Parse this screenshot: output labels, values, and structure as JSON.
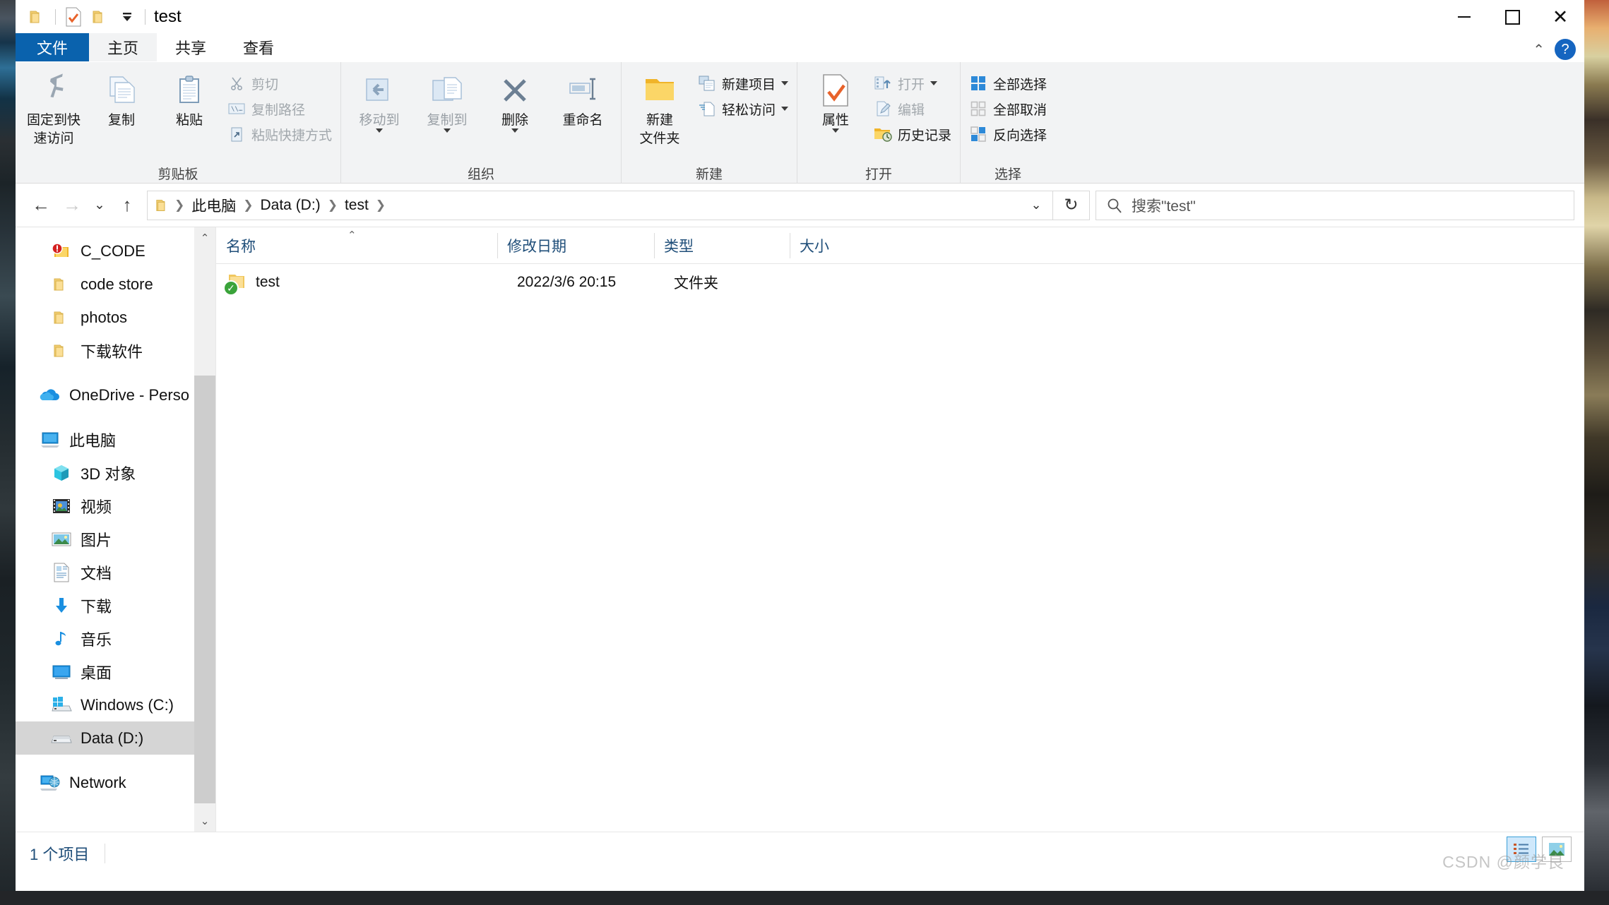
{
  "window": {
    "title": "test",
    "quick_access": [
      {
        "name": "folder-icon",
        "label": "folder"
      },
      {
        "name": "properties-icon",
        "label": "properties"
      },
      {
        "name": "new-folder-icon",
        "label": "new folder"
      },
      {
        "name": "customize-dropdown-icon",
        "label": "customize"
      }
    ],
    "controls": {
      "minimize": "minimize-icon",
      "maximize": "maximize-icon",
      "close": "close-icon"
    }
  },
  "tabs": [
    {
      "label": "文件",
      "key": "file",
      "active": false
    },
    {
      "label": "主页",
      "key": "home",
      "active": true
    },
    {
      "label": "共享",
      "key": "share",
      "active": false
    },
    {
      "label": "查看",
      "key": "view",
      "active": false
    }
  ],
  "ribbon_right": {
    "collapse_icon": "chevron-up-icon",
    "help_label": "?"
  },
  "ribbon": {
    "groups": [
      {
        "title": "剪贴板",
        "big": [
          {
            "label": "固定到快\n速访问",
            "label_line1": "固定到快",
            "label_line2": "速访问",
            "icon": "pin-icon",
            "dim": false
          },
          {
            "label": "复制",
            "icon": "copy-icon",
            "dim": false
          },
          {
            "label": "粘贴",
            "icon": "paste-icon",
            "dim": false
          }
        ],
        "small": [
          {
            "label": "剪切",
            "icon": "scissors-icon",
            "dim": true
          },
          {
            "label": "复制路径",
            "icon": "copy-path-icon",
            "dim": true
          },
          {
            "label": "粘贴快捷方式",
            "icon": "paste-shortcut-icon",
            "dim": true
          }
        ]
      },
      {
        "title": "组织",
        "big": [
          {
            "label": "移动到",
            "icon": "move-to-icon",
            "dim": true,
            "caret": true
          },
          {
            "label": "复制到",
            "icon": "copy-to-icon",
            "dim": true,
            "caret": true
          },
          {
            "label": "删除",
            "icon": "delete-x-icon",
            "dim": false,
            "caret": true
          },
          {
            "label": "重命名",
            "icon": "rename-icon",
            "dim": false,
            "caret": false
          }
        ],
        "small": []
      },
      {
        "title": "新建",
        "big": [
          {
            "label_line1": "新建",
            "label_line2": "文件夹",
            "label": "新建文件夹",
            "icon": "new-folder-big-icon",
            "dim": false
          }
        ],
        "small": [
          {
            "label": "新建项目",
            "icon": "new-item-icon",
            "dim": false,
            "caret": true
          },
          {
            "label": "轻松访问",
            "icon": "easy-access-icon",
            "dim": false,
            "caret": true
          }
        ]
      },
      {
        "title": "打开",
        "big": [
          {
            "label": "属性",
            "icon": "properties-big-icon",
            "dim": false,
            "caret": true
          }
        ],
        "small": [
          {
            "label": "打开",
            "icon": "open-icon",
            "dim": true,
            "caret": true
          },
          {
            "label": "编辑",
            "icon": "edit-icon",
            "dim": true,
            "caret": false
          },
          {
            "label": "历史记录",
            "icon": "history-icon",
            "dim": false,
            "caret": false
          }
        ]
      },
      {
        "title": "选择",
        "big": [],
        "small": [
          {
            "label": "全部选择",
            "icon": "select-all-icon",
            "dim": false
          },
          {
            "label": "全部取消",
            "icon": "select-none-icon",
            "dim": false
          },
          {
            "label": "反向选择",
            "icon": "invert-selection-icon",
            "dim": false
          }
        ]
      }
    ]
  },
  "address": {
    "back_icon": "back-arrow-icon",
    "forward_icon": "forward-arrow-icon",
    "recent_icon": "chevron-down-icon",
    "up_icon": "up-arrow-icon",
    "folder_icon": "folder-icon",
    "crumbs": [
      "此电脑",
      "Data (D:)",
      "test"
    ],
    "dropdown_icon": "chevron-down-icon",
    "refresh_icon": "refresh-icon"
  },
  "search": {
    "icon": "search-icon",
    "placeholder": "搜索\"test\""
  },
  "sidebar": {
    "items": [
      {
        "label": "C_CODE",
        "icon": "folder-error-icon",
        "indent": true,
        "selected": false
      },
      {
        "label": "code store",
        "icon": "folder-icon",
        "indent": true,
        "selected": false
      },
      {
        "label": "photos",
        "icon": "folder-icon",
        "indent": true,
        "selected": false
      },
      {
        "label": "下载软件",
        "icon": "folder-icon",
        "indent": true,
        "selected": false
      },
      {
        "label": "OneDrive - Perso",
        "icon": "onedrive-icon",
        "indent": false,
        "selected": false,
        "gap_before": true
      },
      {
        "label": "此电脑",
        "icon": "this-pc-icon",
        "indent": false,
        "selected": false,
        "gap_before": true
      },
      {
        "label": "3D 对象",
        "icon": "3d-objects-icon",
        "indent": true,
        "selected": false
      },
      {
        "label": "视频",
        "icon": "videos-icon",
        "indent": true,
        "selected": false
      },
      {
        "label": "图片",
        "icon": "pictures-icon",
        "indent": true,
        "selected": false
      },
      {
        "label": "文档",
        "icon": "documents-icon",
        "indent": true,
        "selected": false
      },
      {
        "label": "下载",
        "icon": "downloads-icon",
        "indent": true,
        "selected": false
      },
      {
        "label": "音乐",
        "icon": "music-icon",
        "indent": true,
        "selected": false
      },
      {
        "label": "桌面",
        "icon": "desktop-icon",
        "indent": true,
        "selected": false
      },
      {
        "label": "Windows (C:)",
        "icon": "windows-drive-icon",
        "indent": true,
        "selected": false
      },
      {
        "label": "Data (D:)",
        "icon": "drive-icon",
        "indent": true,
        "selected": true
      },
      {
        "label": "Network",
        "icon": "network-icon",
        "indent": false,
        "selected": false,
        "gap_before": true
      }
    ]
  },
  "filelist": {
    "columns": [
      "名称",
      "修改日期",
      "类型",
      "大小"
    ],
    "sort_indicator": "sort-ascending-icon",
    "rows": [
      {
        "name": "test",
        "date": "2022/3/6 20:15",
        "type": "文件夹",
        "size": "",
        "icon": "folder-icon",
        "badge": "sync-ok-badge"
      }
    ]
  },
  "statusbar": {
    "item_count": "1 个项目",
    "views": [
      {
        "name": "details-view-button",
        "active": true
      },
      {
        "name": "thumbnail-view-button",
        "active": false
      }
    ],
    "watermark": "CSDN @颜学良"
  }
}
